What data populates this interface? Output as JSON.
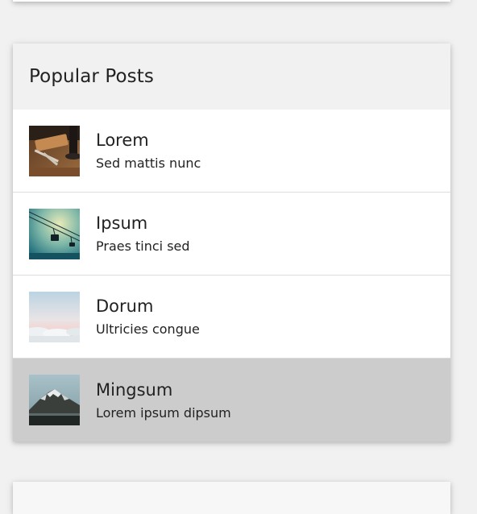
{
  "widget": {
    "title": "Popular Posts",
    "posts": [
      {
        "title": "Lorem",
        "subtitle": "Sed mattis nunc",
        "thumbnail": "workspace-photo",
        "active": false
      },
      {
        "title": "Ipsum",
        "subtitle": "Praes tinci sed",
        "thumbnail": "cable-car-photo",
        "active": false
      },
      {
        "title": "Dorum",
        "subtitle": "Ultricies congue",
        "thumbnail": "clouds-photo",
        "active": false
      },
      {
        "title": "Mingsum",
        "subtitle": "Lorem ipsum dipsum",
        "thumbnail": "mountain-photo",
        "active": true
      }
    ]
  },
  "colors": {
    "page_background": "#f1f1f1",
    "header_background": "#f1f1f1",
    "active_row_background": "#cccccc",
    "divider": "#dddddd",
    "text": "#222222"
  }
}
